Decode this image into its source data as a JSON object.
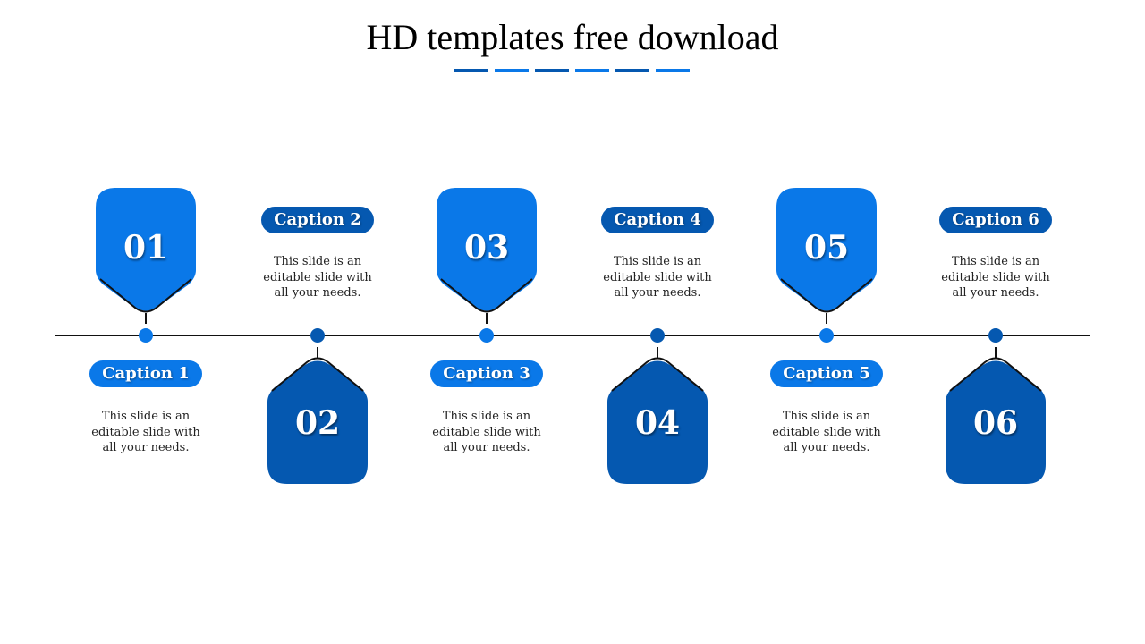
{
  "title": "HD templates free download",
  "colors": {
    "light_blue": "#0A78E8",
    "dark_blue": "#0558B0",
    "line": "#111111"
  },
  "title_dashes": [
    "dark",
    "light",
    "dark",
    "light",
    "dark",
    "light"
  ],
  "steps": [
    {
      "number": "01",
      "caption": "Caption 1",
      "text": "This slide is an editable slide with all your needs.",
      "marker_side": "top",
      "color": "light"
    },
    {
      "number": "02",
      "caption": "Caption 2",
      "text": "This slide is an editable slide with all your needs.",
      "marker_side": "bottom",
      "color": "dark"
    },
    {
      "number": "03",
      "caption": "Caption 3",
      "text": "This slide is an editable slide with all your needs.",
      "marker_side": "top",
      "color": "light"
    },
    {
      "number": "04",
      "caption": "Caption 4",
      "text": "This slide is an editable slide with all your needs.",
      "marker_side": "bottom",
      "color": "dark"
    },
    {
      "number": "05",
      "caption": "Caption 5",
      "text": "This slide is an editable slide with all your needs.",
      "marker_side": "top",
      "color": "light"
    },
    {
      "number": "06",
      "caption": "Caption 6",
      "text": "This slide is an editable slide with all your needs.",
      "marker_side": "bottom",
      "color": "dark"
    }
  ]
}
